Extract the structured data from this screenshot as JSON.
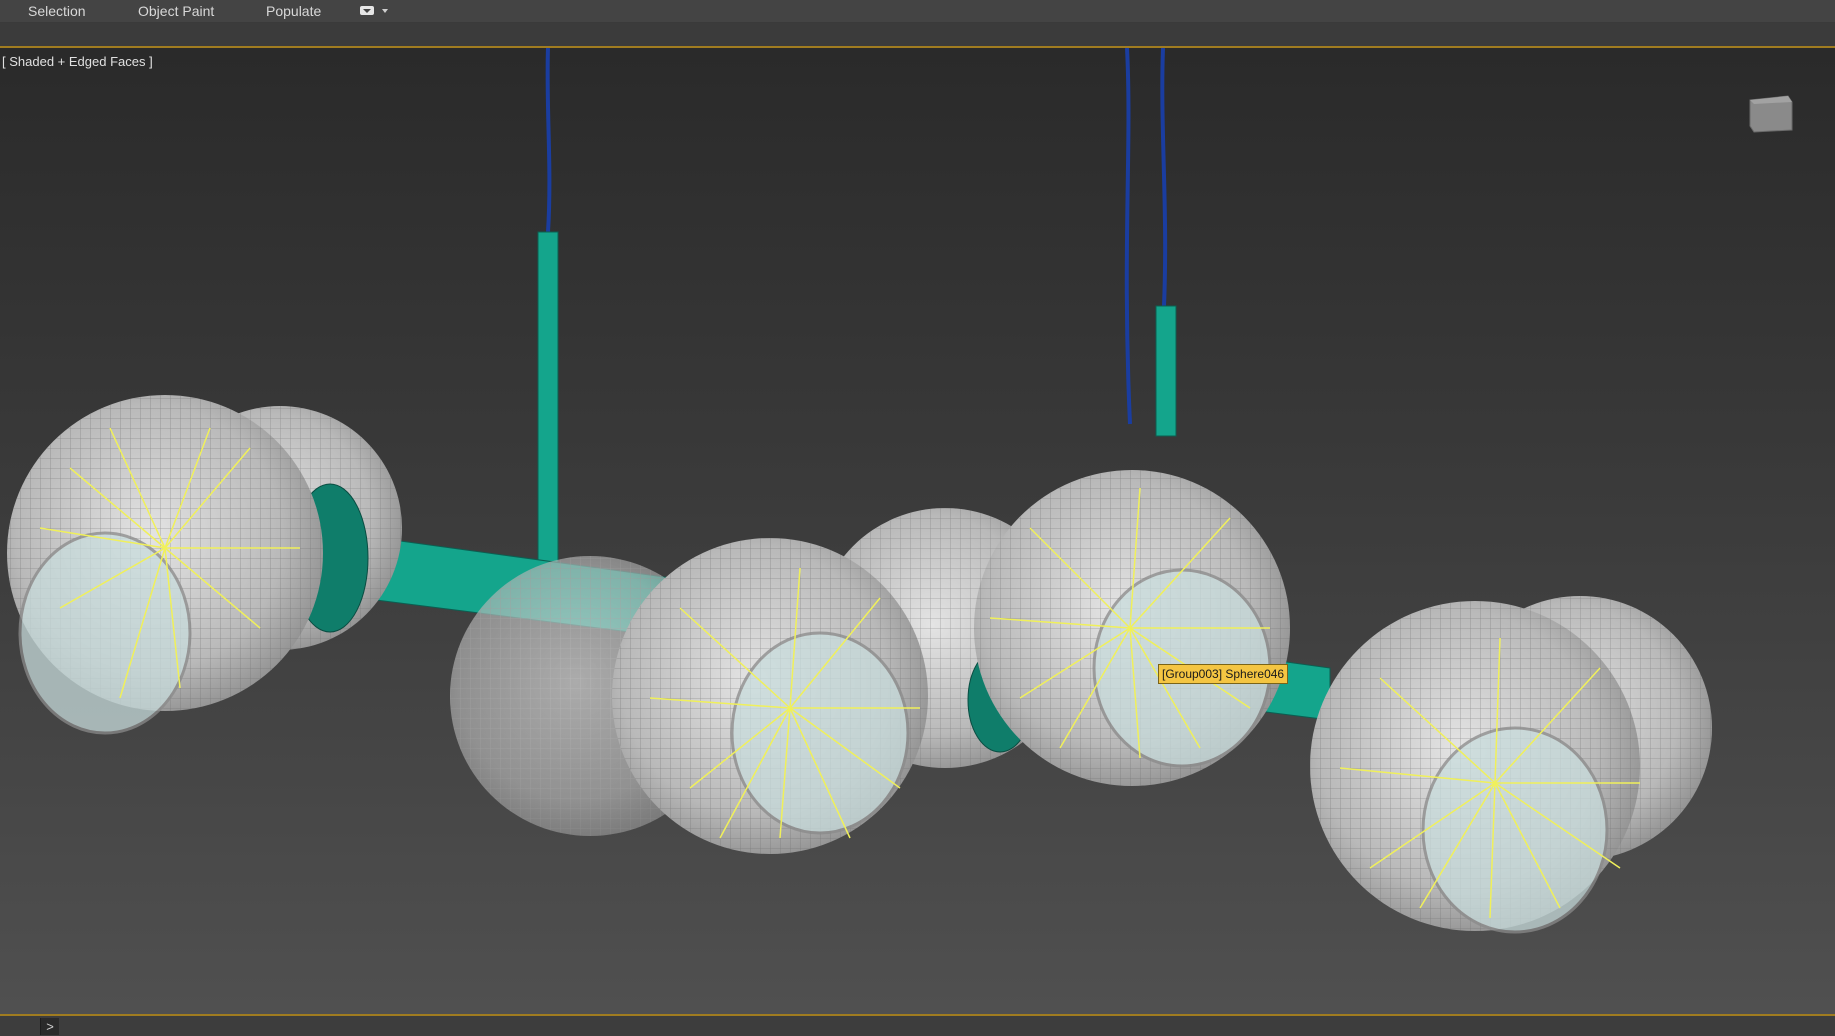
{
  "ribbon": {
    "tabs": [
      "Selection",
      "Object Paint",
      "Populate"
    ],
    "extra_icon": "dropdown-arrow-icon"
  },
  "viewport": {
    "label": "[ Shaded + Edged Faces ]",
    "tooltip": "[Group003] Sphere046",
    "viewcube_icon": "viewcube-icon"
  },
  "colors": {
    "accent_border": "#a07c20",
    "teal": "#14a58c",
    "cable": "#1a3da0",
    "filament": "#f0f05a",
    "tooltip_bg": "#f4c542"
  },
  "statusbar": {
    "prompt": ">"
  }
}
